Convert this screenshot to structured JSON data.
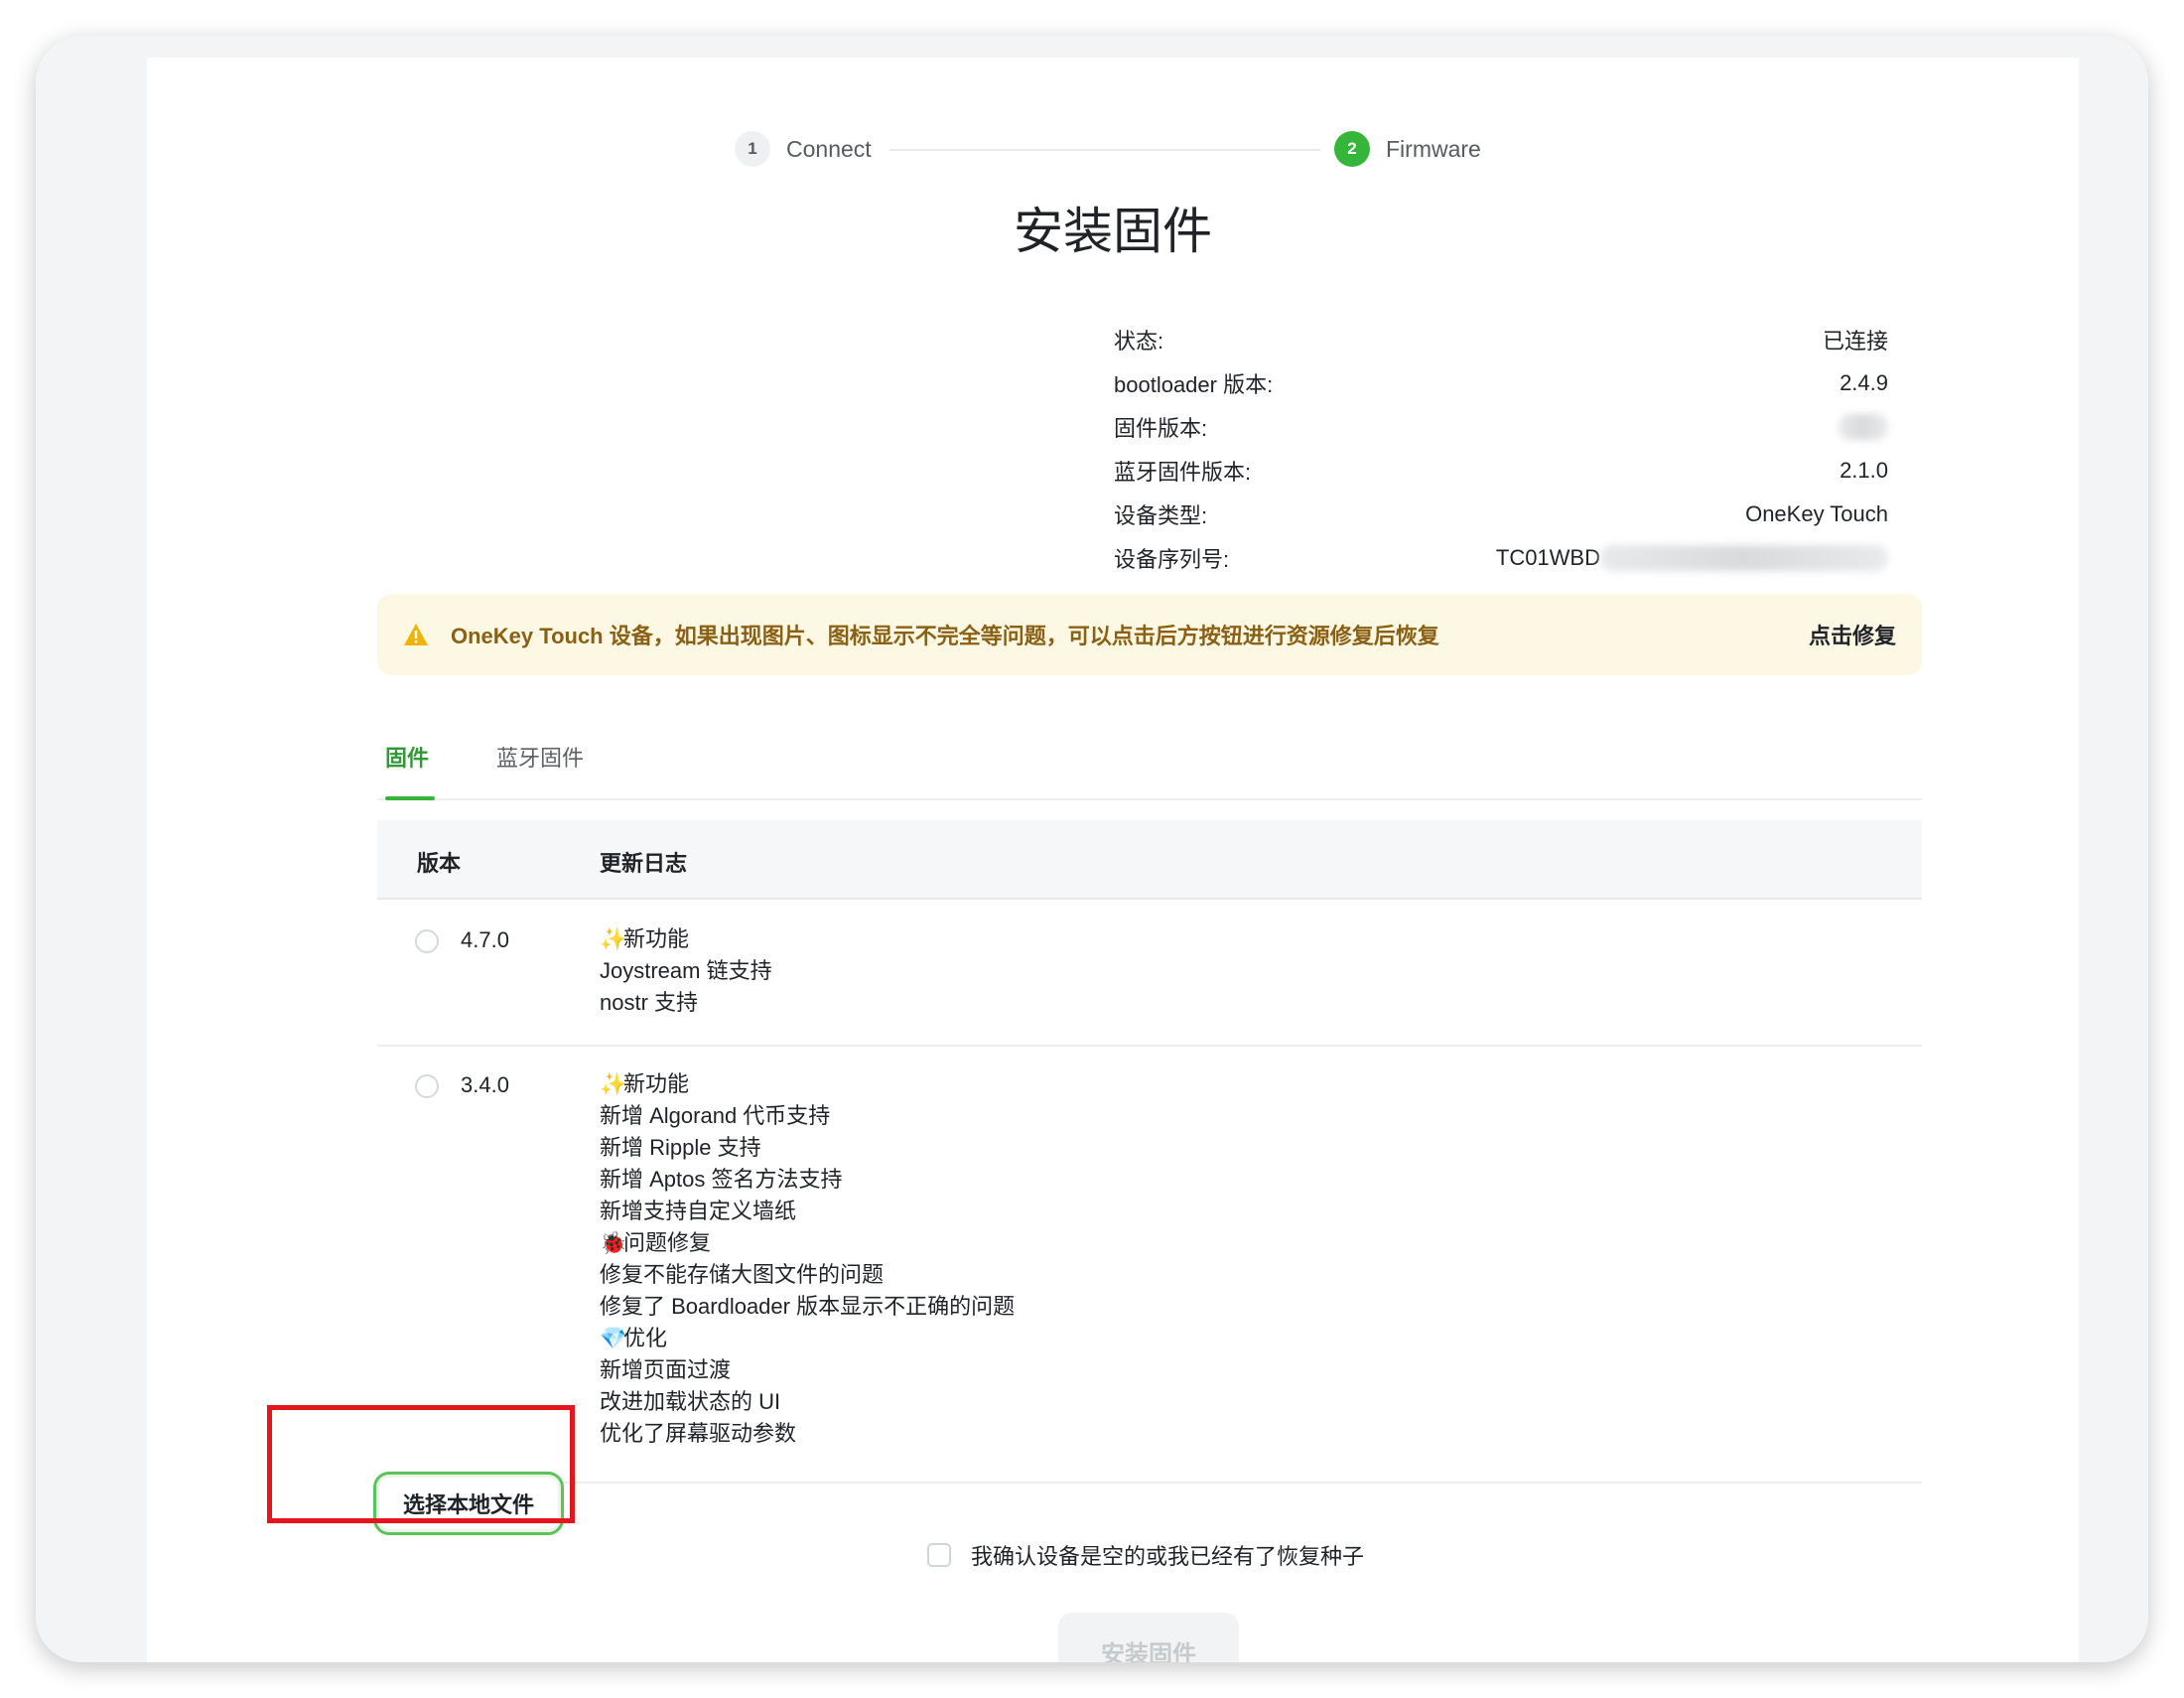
{
  "stepper": {
    "steps": [
      {
        "num": "1",
        "label": "Connect"
      },
      {
        "num": "2",
        "label": "Firmware"
      }
    ]
  },
  "title": "安装固件",
  "info": {
    "status": {
      "label": "状态:",
      "value": "已连接"
    },
    "bootloader": {
      "label": "bootloader 版本:",
      "value": "2.4.9"
    },
    "firmware": {
      "label": "固件版本:",
      "value": ""
    },
    "bluetooth": {
      "label": "蓝牙固件版本:",
      "value": "2.1.0"
    },
    "device_type": {
      "label": "设备类型:",
      "value": "OneKey Touch"
    },
    "serial": {
      "label": "设备序列号:",
      "value": "TC01WBD"
    }
  },
  "warning": {
    "text": "OneKey Touch 设备，如果出现图片、图标显示不完全等问题，可以点击后方按钮进行资源修复后恢复",
    "action": "点击修复",
    "color": "#8a6114"
  },
  "tabs": {
    "firmware": "固件",
    "bluetooth": "蓝牙固件",
    "active_color": "#35b53a"
  },
  "table": {
    "headers": {
      "version": "版本",
      "changelog": "更新日志"
    },
    "rows": [
      {
        "version": "4.7.0",
        "lines": [
          {
            "icon": "✨",
            "text": "新功能"
          },
          {
            "icon": "",
            "text": "Joystream 链支持"
          },
          {
            "icon": "",
            "text": "nostr 支持"
          }
        ]
      },
      {
        "version": "3.4.0",
        "lines": [
          {
            "icon": "✨",
            "text": "新功能"
          },
          {
            "icon": "",
            "text": "新增 Algorand 代币支持"
          },
          {
            "icon": "",
            "text": "新增 Ripple 支持"
          },
          {
            "icon": "",
            "text": "新增 Aptos 签名方法支持"
          },
          {
            "icon": "",
            "text": "新增支持自定义墙纸"
          },
          {
            "icon": "🐞",
            "text": "问题修复"
          },
          {
            "icon": "",
            "text": "修复不能存储大图文件的问题"
          },
          {
            "icon": "",
            "text": "修复了 Boardloader 版本显示不正确的问题"
          },
          {
            "icon": "💎",
            "text": "优化"
          },
          {
            "icon": "",
            "text": "新增页面过渡"
          },
          {
            "icon": "",
            "text": "改进加载状态的 UI"
          },
          {
            "icon": "",
            "text": "优化了屏幕驱动参数"
          }
        ]
      }
    ]
  },
  "local_file_button": "选择本地文件",
  "confirm_text": "我确认设备是空的或我已经有了恢复种子",
  "install_button": "安装固件",
  "highlight_color": "#e4151c"
}
